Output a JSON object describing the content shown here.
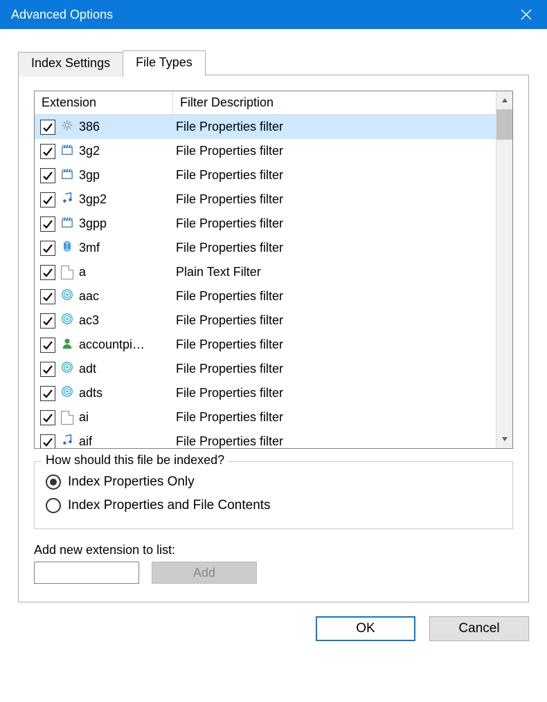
{
  "title": "Advanced Options",
  "tabs": {
    "index_settings": "Index Settings",
    "file_types": "File Types"
  },
  "columns": {
    "extension": "Extension",
    "filter_desc": "Filter Description"
  },
  "rows": [
    {
      "ext": "386",
      "desc": "File Properties filter",
      "checked": true,
      "icon": "gear",
      "selected": true
    },
    {
      "ext": "3g2",
      "desc": "File Properties filter",
      "checked": true,
      "icon": "clap"
    },
    {
      "ext": "3gp",
      "desc": "File Properties filter",
      "checked": true,
      "icon": "clap"
    },
    {
      "ext": "3gp2",
      "desc": "File Properties filter",
      "checked": true,
      "icon": "music"
    },
    {
      "ext": "3gpp",
      "desc": "File Properties filter",
      "checked": true,
      "icon": "clap"
    },
    {
      "ext": "3mf",
      "desc": "File Properties filter",
      "checked": true,
      "icon": "3d"
    },
    {
      "ext": "a",
      "desc": "Plain Text Filter",
      "checked": true,
      "icon": "blank"
    },
    {
      "ext": "aac",
      "desc": "File Properties filter",
      "checked": true,
      "icon": "disc"
    },
    {
      "ext": "ac3",
      "desc": "File Properties filter",
      "checked": true,
      "icon": "disc"
    },
    {
      "ext": "accountpi…",
      "desc": "File Properties filter",
      "checked": true,
      "icon": "person"
    },
    {
      "ext": "adt",
      "desc": "File Properties filter",
      "checked": true,
      "icon": "disc"
    },
    {
      "ext": "adts",
      "desc": "File Properties filter",
      "checked": true,
      "icon": "disc"
    },
    {
      "ext": "ai",
      "desc": "File Properties filter",
      "checked": true,
      "icon": "blank"
    },
    {
      "ext": "aif",
      "desc": "File Properties filter",
      "checked": true,
      "icon": "music"
    }
  ],
  "group": {
    "title": "How should this file be indexed?",
    "opt_props": "Index Properties Only",
    "opt_contents": "Index Properties and File Contents",
    "selected": "props"
  },
  "add": {
    "label": "Add new extension to list:",
    "button": "Add",
    "value": ""
  },
  "buttons": {
    "ok": "OK",
    "cancel": "Cancel"
  }
}
